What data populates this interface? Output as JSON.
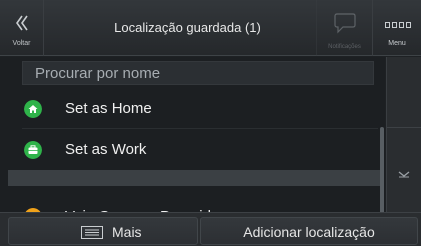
{
  "header": {
    "back_label": "Voltar",
    "title": "Localização guardada (1)",
    "notifications_label": "Notificações",
    "menu_label": "Menu"
  },
  "search": {
    "placeholder": "Procurar por nome"
  },
  "list": {
    "items": [
      {
        "label": "Set as Home",
        "icon": "home-icon",
        "color": "#2fb34a"
      },
      {
        "label": "Set as Work",
        "icon": "briefcase-icon",
        "color": "#2fb34a"
      },
      {
        "label": "Voie Georges Pompidou",
        "icon": "star-icon",
        "color": "#f0a21a"
      }
    ]
  },
  "footer": {
    "more_label": "Mais",
    "add_label": "Adicionar localização"
  }
}
